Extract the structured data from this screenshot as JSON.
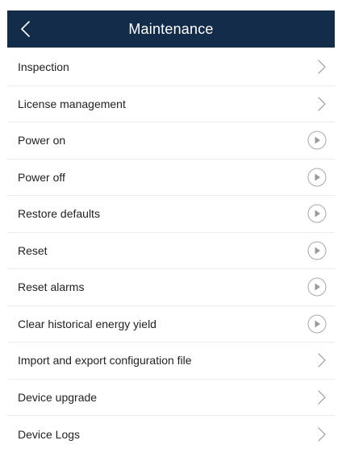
{
  "header": {
    "title": "Maintenance",
    "back_icon": "chevron-left-icon",
    "background": "#132c4a"
  },
  "menu": {
    "items": [
      {
        "label": "Inspection",
        "icon": "chevron-right-icon"
      },
      {
        "label": "License management",
        "icon": "chevron-right-icon"
      },
      {
        "label": "Power on",
        "icon": "play-circle-icon"
      },
      {
        "label": "Power off",
        "icon": "play-circle-icon"
      },
      {
        "label": "Restore defaults",
        "icon": "play-circle-icon"
      },
      {
        "label": "Reset",
        "icon": "play-circle-icon"
      },
      {
        "label": "Reset alarms",
        "icon": "play-circle-icon"
      },
      {
        "label": "Clear historical energy yield",
        "icon": "play-circle-icon"
      },
      {
        "label": "Import and export configuration file",
        "icon": "chevron-right-icon"
      },
      {
        "label": "Device upgrade",
        "icon": "chevron-right-icon"
      },
      {
        "label": "Device Logs",
        "icon": "chevron-right-icon"
      }
    ]
  }
}
